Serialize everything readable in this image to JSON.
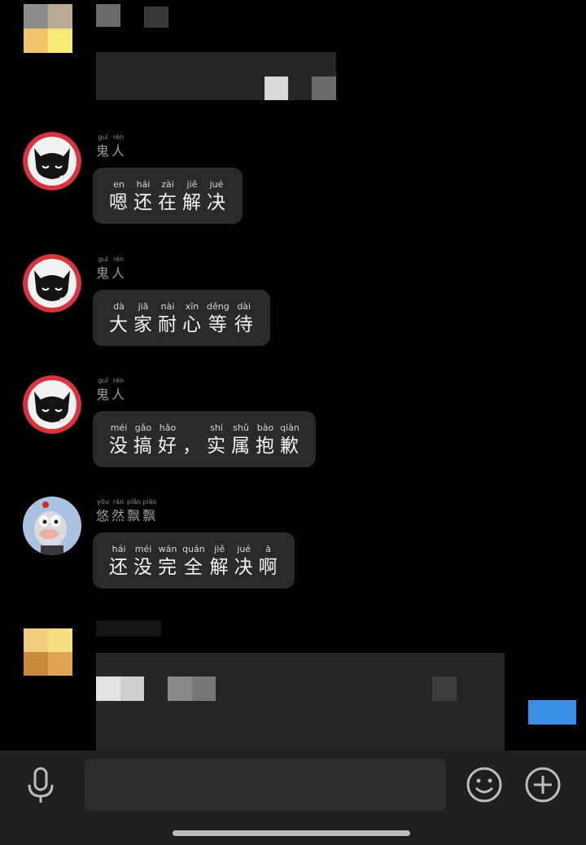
{
  "colors": {
    "background": "#000000",
    "bubble": "#2a2a2a",
    "bar": "#1f1f1f",
    "accent": "#3a8ee6"
  },
  "messages": [
    {
      "sender": [
        {
          "h": "鬼",
          "p": "guǐ"
        },
        {
          "h": "人",
          "p": "rén"
        }
      ],
      "text": [
        {
          "h": "嗯",
          "p": "en"
        },
        {
          "h": "还",
          "p": "hái"
        },
        {
          "h": "在",
          "p": "zài"
        },
        {
          "h": "解",
          "p": "jiě"
        },
        {
          "h": "决",
          "p": "jué"
        }
      ]
    },
    {
      "sender": [
        {
          "h": "鬼",
          "p": "guǐ"
        },
        {
          "h": "人",
          "p": "rén"
        }
      ],
      "text": [
        {
          "h": "大",
          "p": "dà"
        },
        {
          "h": "家",
          "p": "jiā"
        },
        {
          "h": "耐",
          "p": "nài"
        },
        {
          "h": "心",
          "p": "xīn"
        },
        {
          "h": "等",
          "p": "děng"
        },
        {
          "h": "待",
          "p": "dài"
        }
      ]
    },
    {
      "sender": [
        {
          "h": "鬼",
          "p": "guǐ"
        },
        {
          "h": "人",
          "p": "rén"
        }
      ],
      "text": [
        {
          "h": "没",
          "p": "méi"
        },
        {
          "h": "搞",
          "p": "gǎo"
        },
        {
          "h": "好",
          "p": "hǎo"
        },
        {
          "h": "，",
          "p": ""
        },
        {
          "h": "实",
          "p": "shí"
        },
        {
          "h": "属",
          "p": "shǔ"
        },
        {
          "h": "抱",
          "p": "bào"
        },
        {
          "h": "歉",
          "p": "qiàn"
        }
      ]
    },
    {
      "sender": [
        {
          "h": "悠",
          "p": "yōu"
        },
        {
          "h": "然",
          "p": "rán"
        },
        {
          "h": "飘",
          "p": "piāo"
        },
        {
          "h": "飘",
          "p": "piāo"
        }
      ],
      "text": [
        {
          "h": "还",
          "p": "hái"
        },
        {
          "h": "没",
          "p": "méi"
        },
        {
          "h": "完",
          "p": "wán"
        },
        {
          "h": "全",
          "p": "quán"
        },
        {
          "h": "解",
          "p": "jiě"
        },
        {
          "h": "决",
          "p": "jué"
        },
        {
          "h": "啊",
          "p": "ā"
        }
      ]
    }
  ],
  "icons": {
    "mic": "microphone-icon",
    "emoji": "emoji-icon",
    "plus": "plus-icon"
  }
}
